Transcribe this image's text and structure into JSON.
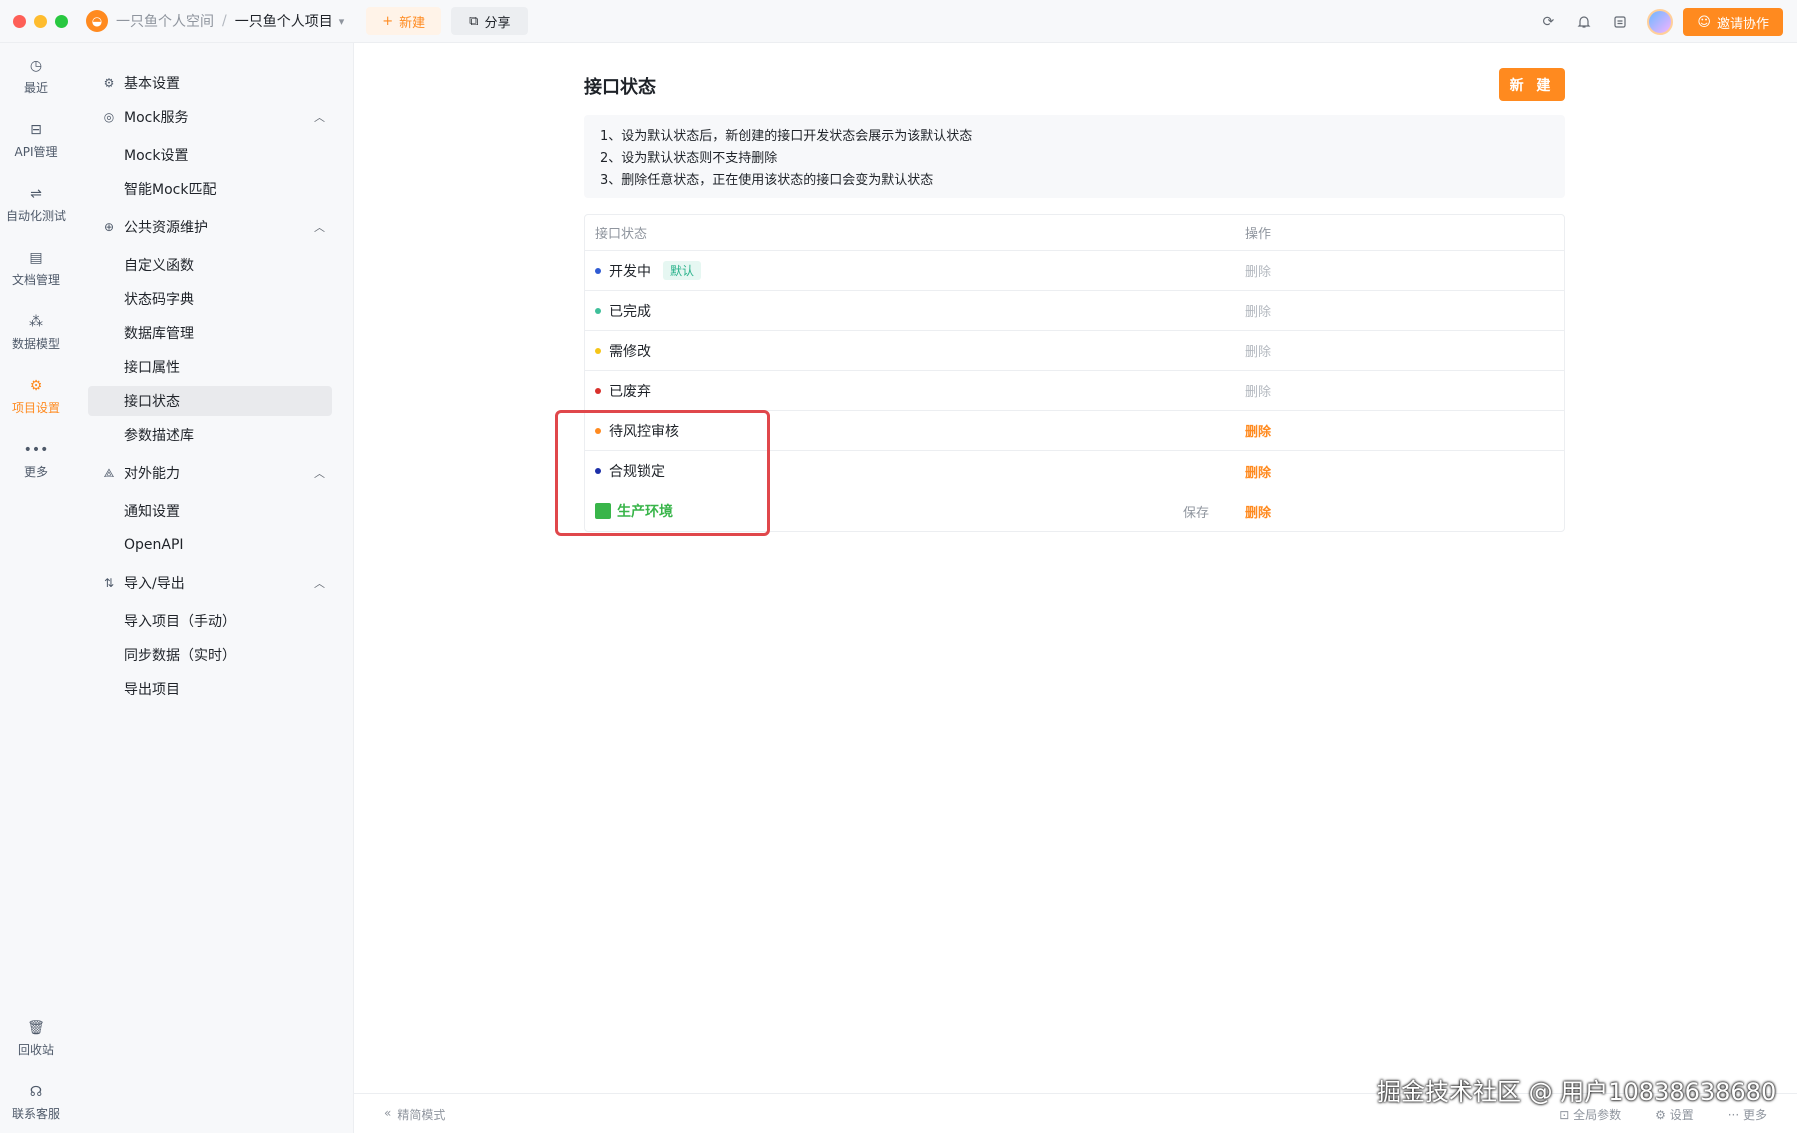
{
  "titlebar": {
    "space": "一只鱼个人空间",
    "separator": "/",
    "project": "一只鱼个人项目",
    "new_label": "新建",
    "share_label": "分享",
    "invite_label": "邀请协作"
  },
  "rail": {
    "items": [
      {
        "label": "最近",
        "icon": "history-icon"
      },
      {
        "label": "API管理",
        "icon": "api-icon"
      },
      {
        "label": "自动化测试",
        "icon": "automation-icon"
      },
      {
        "label": "文档管理",
        "icon": "document-icon"
      },
      {
        "label": "数据模型",
        "icon": "data-model-icon"
      },
      {
        "label": "项目设置",
        "icon": "project-settings-icon"
      },
      {
        "label": "更多",
        "icon": "more-icon"
      }
    ],
    "bottom": [
      {
        "label": "回收站",
        "icon": "trash-icon"
      },
      {
        "label": "联系客服",
        "icon": "headset-icon"
      }
    ]
  },
  "sidebar": {
    "basic": "基本设置",
    "mock_group": "Mock服务",
    "mock_items": [
      "Mock设置",
      "智能Mock匹配"
    ],
    "public_group": "公共资源维护",
    "public_items": [
      "自定义函数",
      "状态码字典",
      "数据库管理",
      "接口属性",
      "接口状态",
      "参数描述库"
    ],
    "external_group": "对外能力",
    "external_items": [
      "通知设置",
      "OpenAPI"
    ],
    "io_group": "导入/导出",
    "io_items": [
      "导入项目（手动）",
      "同步数据（实时）",
      "导出项目"
    ]
  },
  "main": {
    "title": "接口状态",
    "new_button": "新 建",
    "notes": [
      "1、设为默认状态后，新创建的接口开发状态会展示为该默认状态",
      "2、设为默认状态则不支持删除",
      "3、删除任意状态，正在使用该状态的接口会变为默认状态"
    ],
    "table": {
      "col_status": "接口状态",
      "col_action": "操作",
      "rows": [
        {
          "name": "开发中",
          "color": "#2f5bd3",
          "tag": "默认",
          "action": "删除",
          "action_active": false
        },
        {
          "name": "已完成",
          "color": "#3fbf9a",
          "tag": "",
          "action": "删除",
          "action_active": false
        },
        {
          "name": "需修改",
          "color": "#f5c518",
          "tag": "",
          "action": "删除",
          "action_active": false
        },
        {
          "name": "已废弃",
          "color": "#d9302c",
          "tag": "",
          "action": "删除",
          "action_active": false
        },
        {
          "name": "待风控审核",
          "color": "#ff8a1f",
          "tag": "",
          "action": "删除",
          "action_active": true
        },
        {
          "name": "合规锁定",
          "color": "#1c2fa8",
          "tag": "",
          "action": "删除",
          "action_active": true
        }
      ],
      "edit_row": {
        "name": "生产环境",
        "color": "#39b54a",
        "save": "保存",
        "action": "删除"
      }
    }
  },
  "footer": {
    "simple_mode": "精简模式",
    "global_params": "全局参数",
    "settings": "设置",
    "more": "更多"
  },
  "watermark": "掘金技术社区 @ 用户10838638680"
}
